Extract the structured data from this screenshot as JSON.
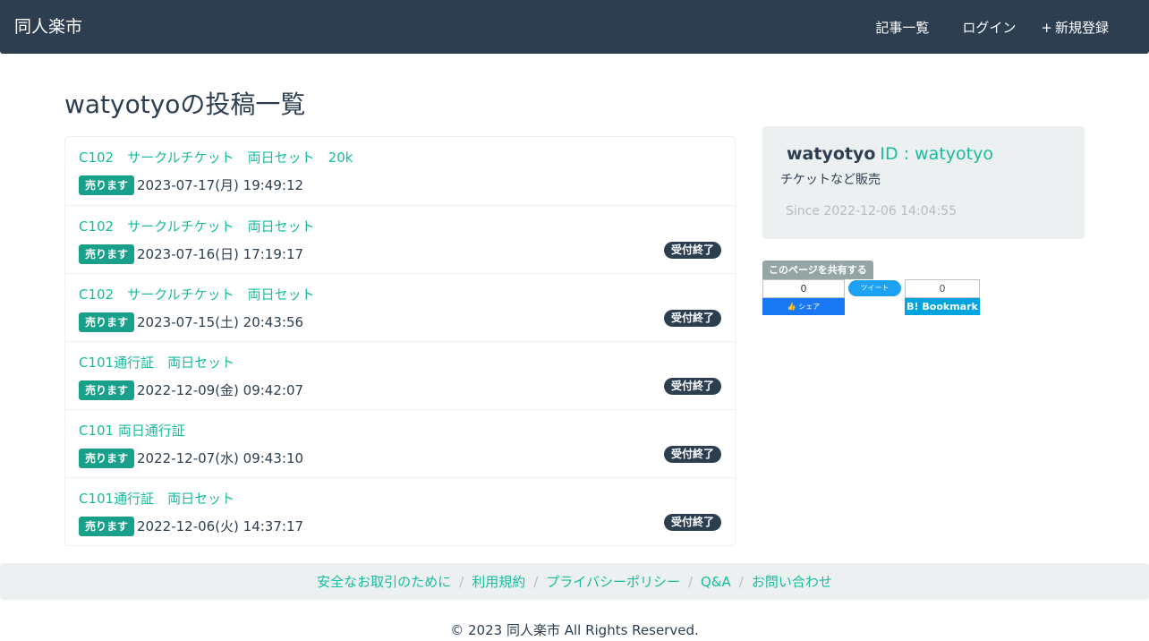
{
  "navbar": {
    "brand": "同人楽市",
    "links": [
      {
        "icon": "",
        "label": "記事一覧"
      },
      {
        "icon": "",
        "label": "ログイン"
      },
      {
        "icon": "+",
        "label": "新規登録"
      }
    ]
  },
  "page_title": "watyotyoの投稿一覧",
  "posts": [
    {
      "title": "C102　サークルチケット　両日セット　20k",
      "badge": "売ります",
      "date": "2023-07-17(月) 19:49:12",
      "status": ""
    },
    {
      "title": "C102　サークルチケット　両日セット",
      "badge": "売ります",
      "date": "2023-07-16(日) 17:19:17",
      "status": "受付終了"
    },
    {
      "title": "C102　サークルチケット　両日セット",
      "badge": "売ります",
      "date": "2023-07-15(土) 20:43:56",
      "status": "受付終了"
    },
    {
      "title": "C101通行証　両日セット",
      "badge": "売ります",
      "date": "2022-12-09(金) 09:42:07",
      "status": "受付終了"
    },
    {
      "title": "C101 両日通行証",
      "badge": "売ります",
      "date": "2022-12-07(水) 09:43:10",
      "status": "受付終了"
    },
    {
      "title": "C101通行証　両日セット",
      "badge": "売ります",
      "date": "2022-12-06(火) 14:37:17",
      "status": "受付終了"
    }
  ],
  "profile": {
    "user_icon": "",
    "username": "watyotyo",
    "id_label": "ID : watyotyo",
    "bio": "チケットなど販売",
    "since_icon": "",
    "since": "Since 2022-12-06 14:04:55"
  },
  "share": {
    "label": "このページを共有する",
    "facebook_count": "0",
    "facebook_label": "👍 シェア",
    "twitter_label": "ツイート",
    "hatena_count": "0",
    "hatena_label": "B! Bookmark"
  },
  "footer": {
    "links": [
      "安全なお取引のために",
      "利用規約",
      "プライバシーポリシー",
      "Q&A",
      "お問い合わせ"
    ],
    "separator": "/",
    "copyright": "© 2023 同人楽市 All Rights Reserved."
  },
  "colors": {
    "navbar": "#2c3e50",
    "accent": "#18bc9c",
    "badge_sell": "#18a08a",
    "badge_closed": "#2c3e50",
    "panel": "#ecf0f1"
  }
}
